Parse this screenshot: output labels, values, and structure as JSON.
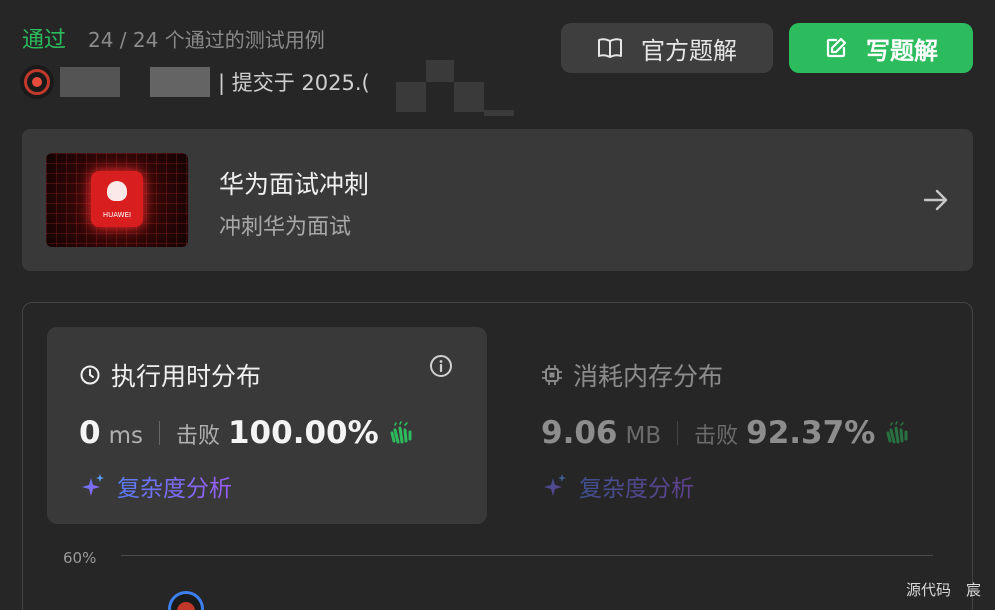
{
  "header": {
    "status": "通过",
    "testcases": "24 / 24 个通过的测试用例",
    "submitted_label": "| 提交于 2025.(",
    "official_solution_label": "官方题解",
    "write_solution_label": "写题解"
  },
  "promo": {
    "title": "华为面试冲刺",
    "subtitle": "冲刺华为面试",
    "logo_text": "HUAWEI"
  },
  "runtime": {
    "title": "执行用时分布",
    "value": "0",
    "unit": "ms",
    "beat_label": "击败",
    "beat_value": "100.00%",
    "analysis": "复杂度分析"
  },
  "memory": {
    "title": "消耗内存分布",
    "value": "9.06",
    "unit": "MB",
    "beat_label": "击败",
    "beat_value": "92.37%",
    "analysis": "复杂度分析"
  },
  "chart": {
    "y_tick": "60%"
  },
  "footer": {
    "text": "源代码　宸"
  },
  "colors": {
    "accent_green": "#2cbb5d",
    "background": "#262626",
    "card": "#393939",
    "analysis_gradient": [
      "#5b7cf7",
      "#9b5cf6"
    ]
  },
  "icons": {
    "official": "book-open-icon",
    "write": "edit-icon",
    "promo_arrow": "arrow-right-icon",
    "runtime": "clock-icon",
    "info": "info-icon",
    "memory": "chip-icon",
    "clap": "clap-icon",
    "analysis": "sparkle-icon"
  }
}
